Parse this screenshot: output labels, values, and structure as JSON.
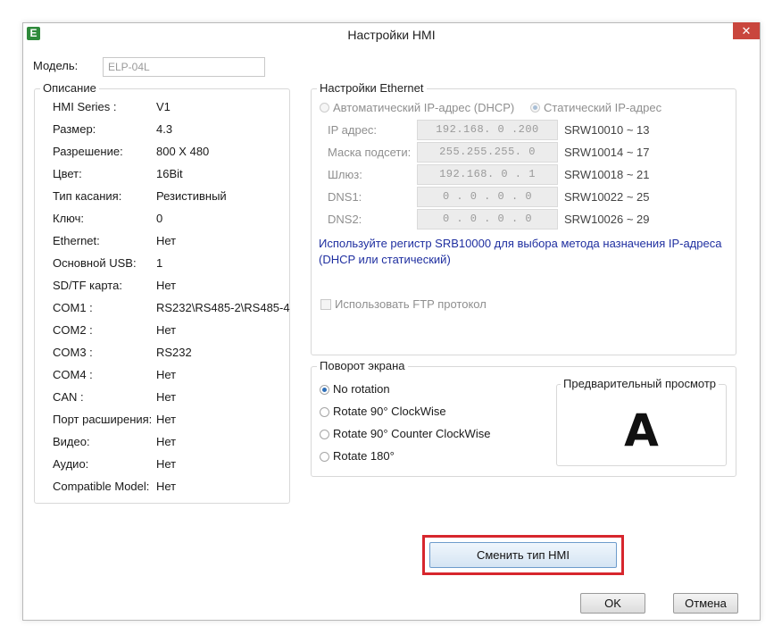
{
  "window": {
    "title": "Настройки HMI",
    "app_icon": "E",
    "close": "✕"
  },
  "model": {
    "label": "Модель:",
    "value": "ELP-04L"
  },
  "description": {
    "title": "Описание",
    "rows": [
      {
        "label": "HMI Series :",
        "value": "V1"
      },
      {
        "label": "Размер:",
        "value": "4.3"
      },
      {
        "label": "Разрешение:",
        "value": "800 X 480"
      },
      {
        "label": "Цвет:",
        "value": "16Bit"
      },
      {
        "label": "Тип касания:",
        "value": "Резистивный"
      },
      {
        "label": "Ключ:",
        "value": "0"
      },
      {
        "label": "Ethernet:",
        "value": "Нет"
      },
      {
        "label": "Основной USB:",
        "value": "1"
      },
      {
        "label": "SD/TF карта:",
        "value": "Нет"
      },
      {
        "label": "COM1 :",
        "value": "RS232\\RS485-2\\RS485-4"
      },
      {
        "label": "COM2 :",
        "value": "Нет"
      },
      {
        "label": "COM3 :",
        "value": "RS232"
      },
      {
        "label": "COM4 :",
        "value": "Нет"
      },
      {
        "label": "CAN :",
        "value": "Нет"
      },
      {
        "label": "Порт расширения:",
        "value": "Нет"
      },
      {
        "label": "Видео:",
        "value": "Нет"
      },
      {
        "label": "Аудио:",
        "value": "Нет"
      },
      {
        "label": "Compatible Model:",
        "value": "Нет"
      }
    ]
  },
  "ethernet": {
    "title": "Настройки Ethernet",
    "dhcp_label": "Автоматический IP-адрес (DHCP)",
    "static_label": "Статический IP-адрес",
    "mode": "static",
    "fields": [
      {
        "label": "IP адрес:",
        "value": "192.168. 0 .200",
        "register": "SRW10010 ~ 13"
      },
      {
        "label": "Маска подсети:",
        "value": "255.255.255. 0",
        "register": "SRW10014 ~ 17"
      },
      {
        "label": "Шлюз:",
        "value": "192.168. 0 . 1",
        "register": "SRW10018 ~ 21"
      },
      {
        "label": "DNS1:",
        "value": "0 . 0 . 0 . 0",
        "register": "SRW10022 ~ 25"
      },
      {
        "label": "DNS2:",
        "value": "0 . 0 . 0 . 0",
        "register": "SRW10026 ~ 29"
      }
    ],
    "note": "Используйте регистр SRB10000 для выбора метода назначения IP-адреса (DHCP или статический)",
    "ftp_label": "Использовать FTP протокол",
    "ftp_checked": false
  },
  "rotation": {
    "title": "Поворот экрана",
    "options": [
      "No rotation",
      "Rotate 90° ClockWise",
      "Rotate 90° Counter ClockWise",
      "Rotate 180°"
    ],
    "selected": 0,
    "preview_title": "Предварительный просмотр",
    "preview_letter": "A"
  },
  "buttons": {
    "change_hmi": "Сменить тип HMI",
    "ok": "OK",
    "cancel": "Отмена"
  },
  "colors": {
    "accent": "#2f6fb8",
    "highlight": "#d7262d",
    "note": "#1f2fa0",
    "close": "#c9463d"
  }
}
